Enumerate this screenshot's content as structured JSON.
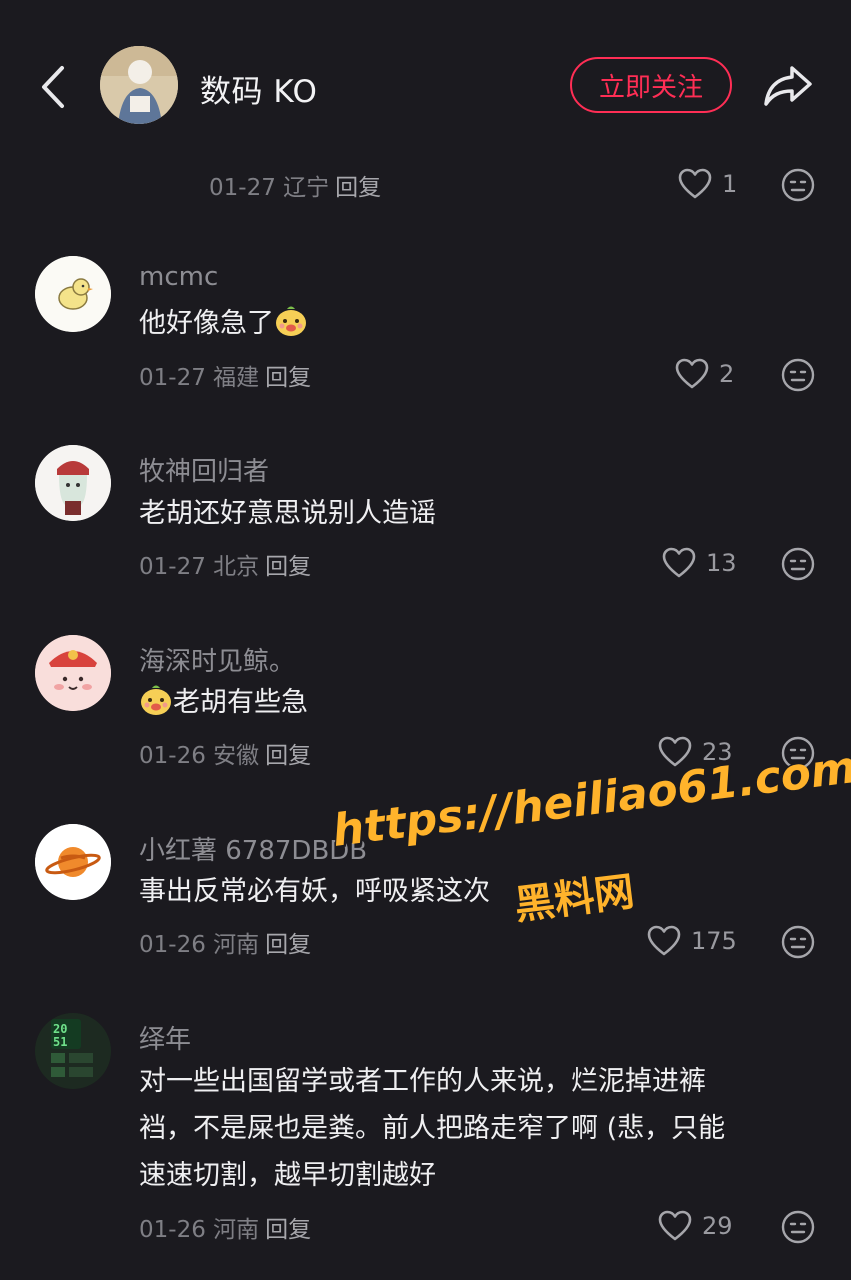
{
  "header": {
    "title": "数码 KO",
    "follow_label": "立即关注",
    "accent": "#ff2e55"
  },
  "first_meta": {
    "date": "01-27",
    "region": "辽宁",
    "reply": "回复",
    "likes": "1"
  },
  "comments": [
    {
      "user": "mcmc",
      "text": "他好像急了",
      "date": "01-27",
      "region": "福建",
      "reply": "回复",
      "likes": "2"
    },
    {
      "user": "牧神回归者",
      "text": "老胡还好意思说别人造谣",
      "date": "01-27",
      "region": "北京",
      "reply": "回复",
      "likes": "13"
    },
    {
      "user": "海深时见鲸。",
      "text": "老胡有些急",
      "date": "01-26",
      "region": "安徽",
      "reply": "回复",
      "likes": "23"
    },
    {
      "user": "小红薯 6787DBDB",
      "text": "事出反常必有妖，呼吸紧这次",
      "date": "01-26",
      "region": "河南",
      "reply": "回复",
      "likes": "175"
    },
    {
      "user": "绎年",
      "text_lines": [
        "对一些出国留学或者工作的人来说，烂泥掉进裤",
        "裆，不是屎也是粪。前人把路走窄了啊 (悲，只能",
        "速速切割，越早切割越好"
      ],
      "date": "01-26",
      "region": "河南",
      "reply": "回复",
      "likes": "29"
    }
  ],
  "watermark": {
    "url": "https://heiliao61.com",
    "name": "黑料网"
  },
  "icons": [
    "back-icon",
    "share-icon",
    "heart-icon",
    "emoji-icon",
    "duck-emoji-icon"
  ]
}
